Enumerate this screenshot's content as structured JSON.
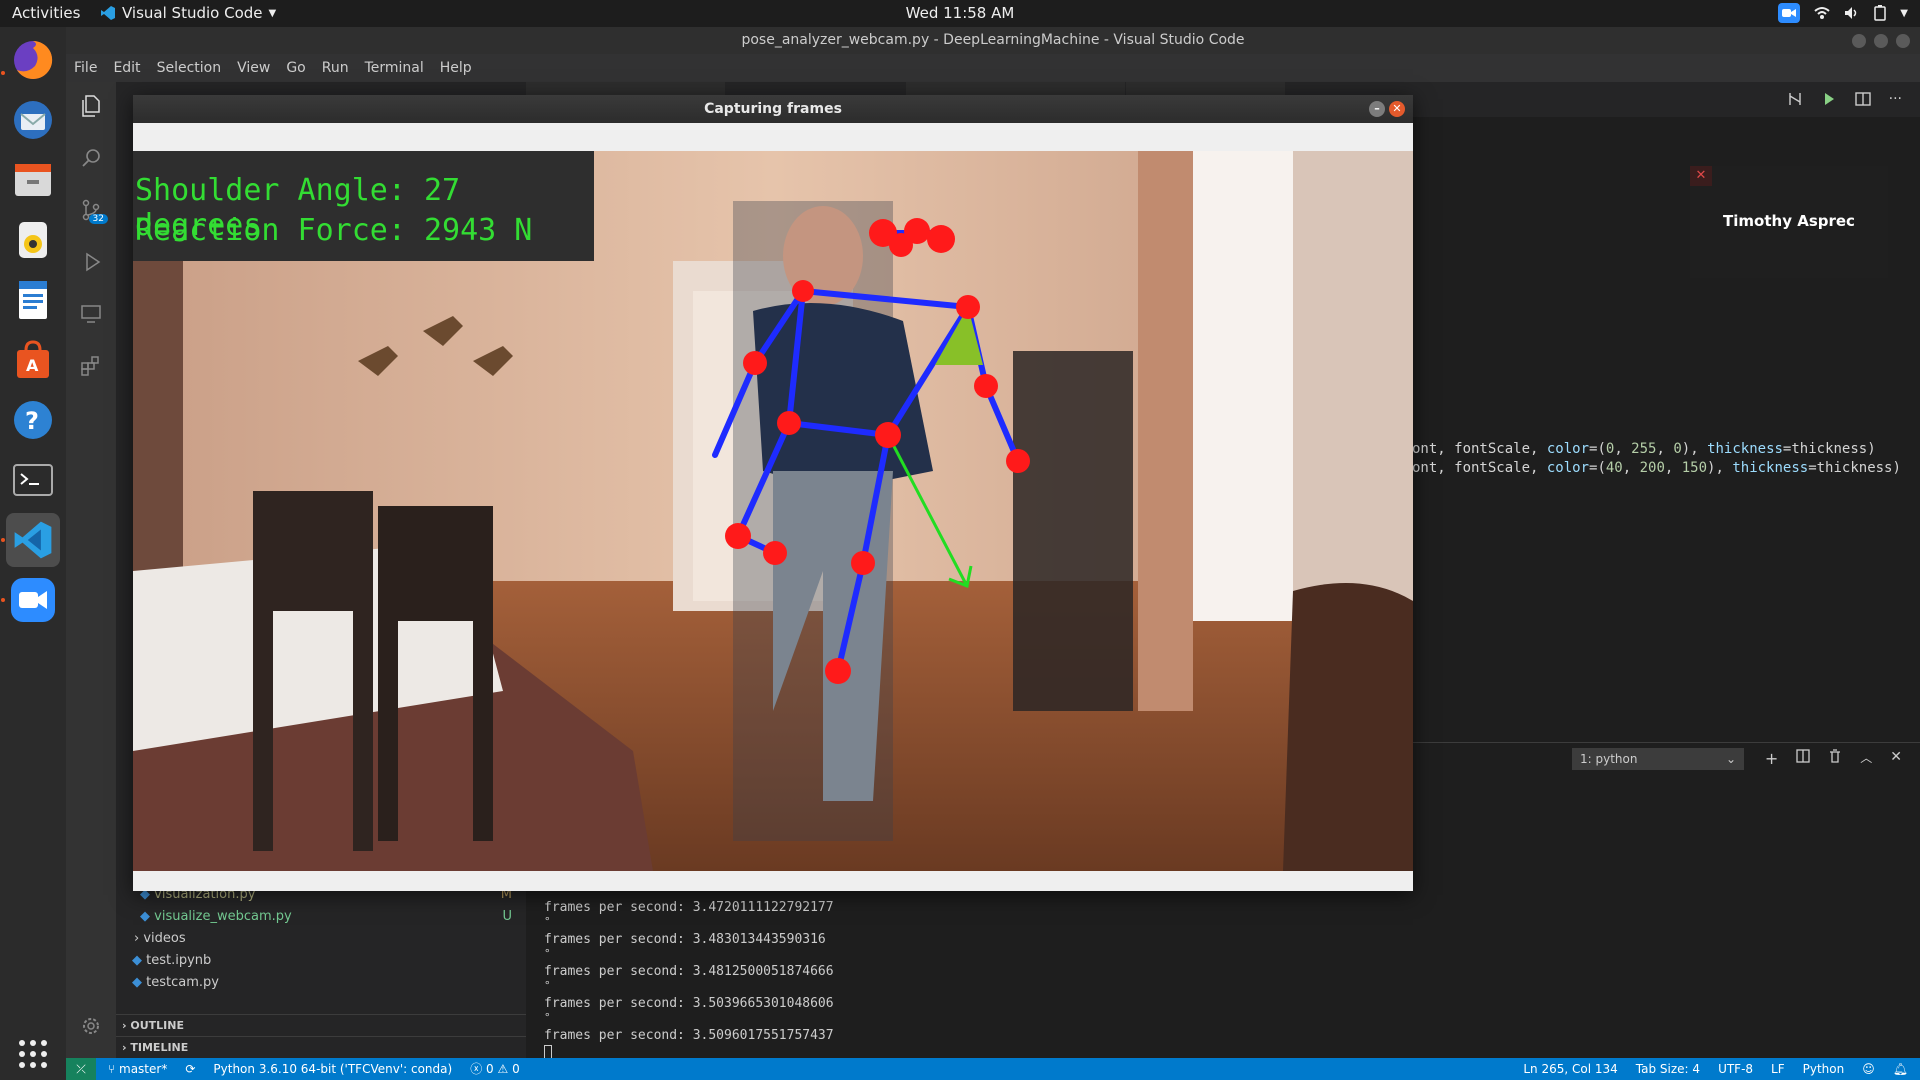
{
  "topbar": {
    "activities": "Activities",
    "app_name": "Visual Studio Code",
    "clock": "Wed 11:58 AM"
  },
  "vscode": {
    "window_title": "pose_analyzer_webcam.py - DeepLearningMachine - Visual Studio Code",
    "menu": [
      "File",
      "Edit",
      "Selection",
      "View",
      "Go",
      "Run",
      "Terminal",
      "Help"
    ],
    "scm_badge": "32",
    "code_lines": [
      {
        "a": "ont, fontScale, ",
        "k1": "color",
        "b": "=(",
        "n1": "0",
        "c": ", ",
        "n2": "255",
        "d": ", ",
        "n3": "0",
        "e": "), ",
        "k2": "thickness",
        "f": "=thickness)"
      },
      {
        "a": "ont, fontScale, ",
        "k1": "color",
        "b": "=(",
        "n1": "40",
        "c": ", ",
        "n2": "200",
        "d": ", ",
        "n3": "150",
        "e": "), ",
        "k2": "thickness",
        "f": "=thickness)"
      }
    ],
    "explorer": {
      "files": [
        {
          "name": "visualization.py",
          "status": "M"
        },
        {
          "name": "visualize_webcam.py",
          "status": "U"
        },
        {
          "name": "videos",
          "status": ""
        },
        {
          "name": "test.ipynb",
          "status": ""
        },
        {
          "name": "testcam.py",
          "status": ""
        }
      ],
      "outline": "OUTLINE",
      "timeline": "TIMELINE"
    },
    "terminal": {
      "selector": "1: python",
      "lines": [
        "frames per second: 3.4720111122792177",
        "frames per second: 3.483013443590316",
        "frames per second: 3.4812500051874666",
        "frames per second: 3.5039665301048606",
        "frames per second: 3.5096017551757437"
      ],
      "degree": "°"
    },
    "status": {
      "branch": "master*",
      "interpreter": "Python 3.6.10 64-bit ('TFCVenv': conda)",
      "problems": "0",
      "warnings": "0",
      "position": "Ln 265, Col 134",
      "tab_size": "Tab Size: 4",
      "encoding": "UTF-8",
      "eol": "LF",
      "language": "Python"
    }
  },
  "zoom": {
    "participant": "Timothy Asprec"
  },
  "capture": {
    "title": "Capturing frames",
    "shoulder_angle": "Shoulder Angle: 27 degrees",
    "reaction_force": "Reaction Force: 2943 N"
  },
  "colors": {
    "accent": "#007acc",
    "overlay_text": "#33dd33",
    "skeleton": "#1e2bff",
    "joint": "#ff1a1a",
    "force_arrow": "#22dd22"
  }
}
